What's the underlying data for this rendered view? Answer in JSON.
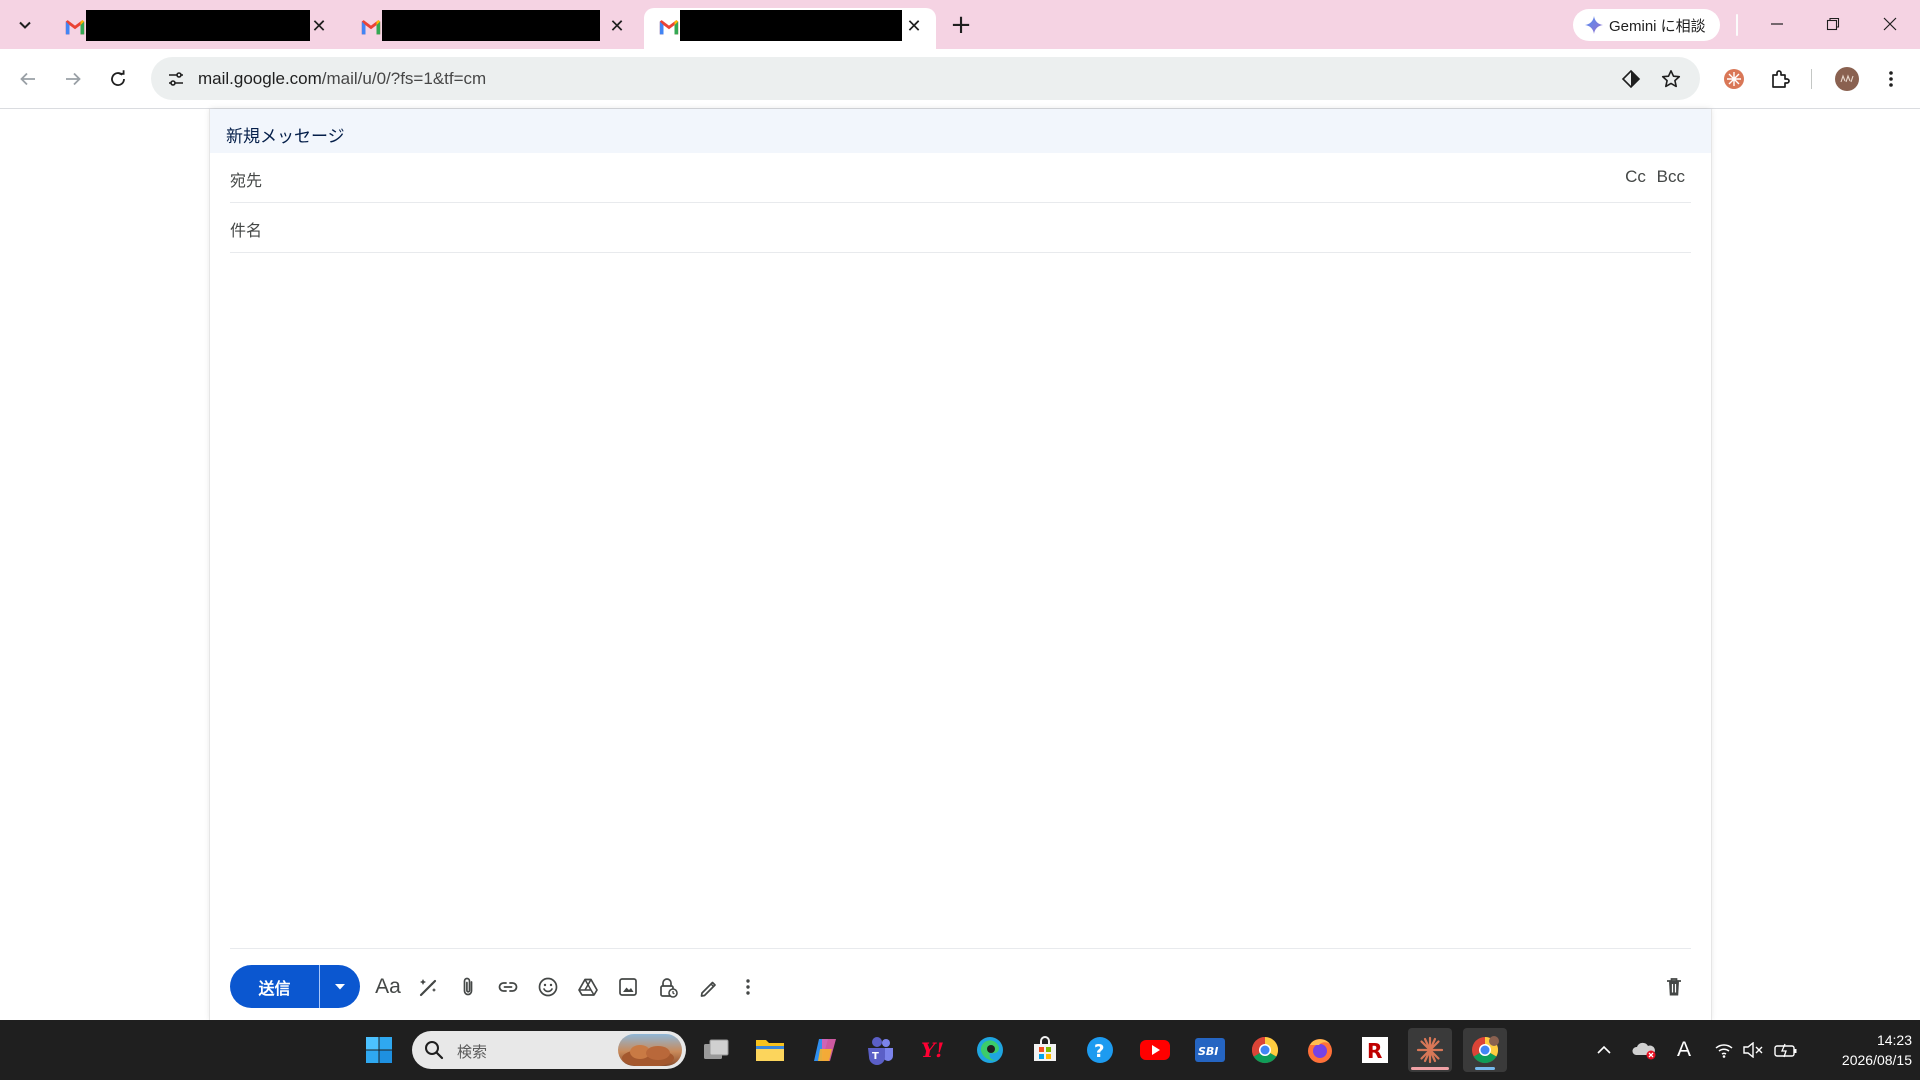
{
  "browser": {
    "tabs": [
      {
        "favicon": "gmail-icon",
        "title": "",
        "redacted": true,
        "active": false
      },
      {
        "favicon": "gmail-icon",
        "title": "",
        "redacted": true,
        "active": false
      },
      {
        "favicon": "gmail-icon",
        "title": "",
        "redacted": true,
        "active": true
      }
    ],
    "gemini_button_label": "Gemini に相談",
    "url_host": "mail.google.com",
    "url_path": "/mail/u/0/?fs=1&tf=cm",
    "colors": {
      "tabstrip": "#f5d3e3",
      "accent": "#0b57d0"
    }
  },
  "compose": {
    "title": "新規メッセージ",
    "to_label": "宛先",
    "cc_label": "Cc",
    "bcc_label": "Bcc",
    "subject_placeholder": "件名",
    "body_value": "",
    "send_label": "送信",
    "toolbar_icons": [
      "formatting-options-icon",
      "magic-write-icon",
      "attach-file-icon",
      "insert-link-icon",
      "insert-emoji-icon",
      "google-drive-icon",
      "insert-photo-icon",
      "confidential-mode-icon",
      "insert-signature-icon",
      "more-options-icon"
    ]
  },
  "taskbar": {
    "search_placeholder": "検索",
    "apps": [
      "start-button",
      "search",
      "task-view",
      "file-explorer",
      "copilot",
      "teams",
      "yahoo",
      "edge",
      "microsoft-store",
      "help",
      "youtube",
      "sbi",
      "chrome",
      "firefox",
      "rakuten",
      "claude",
      "chrome-profile"
    ],
    "input_indicator": "A",
    "time": "14:23",
    "date": "2026/08/15"
  }
}
